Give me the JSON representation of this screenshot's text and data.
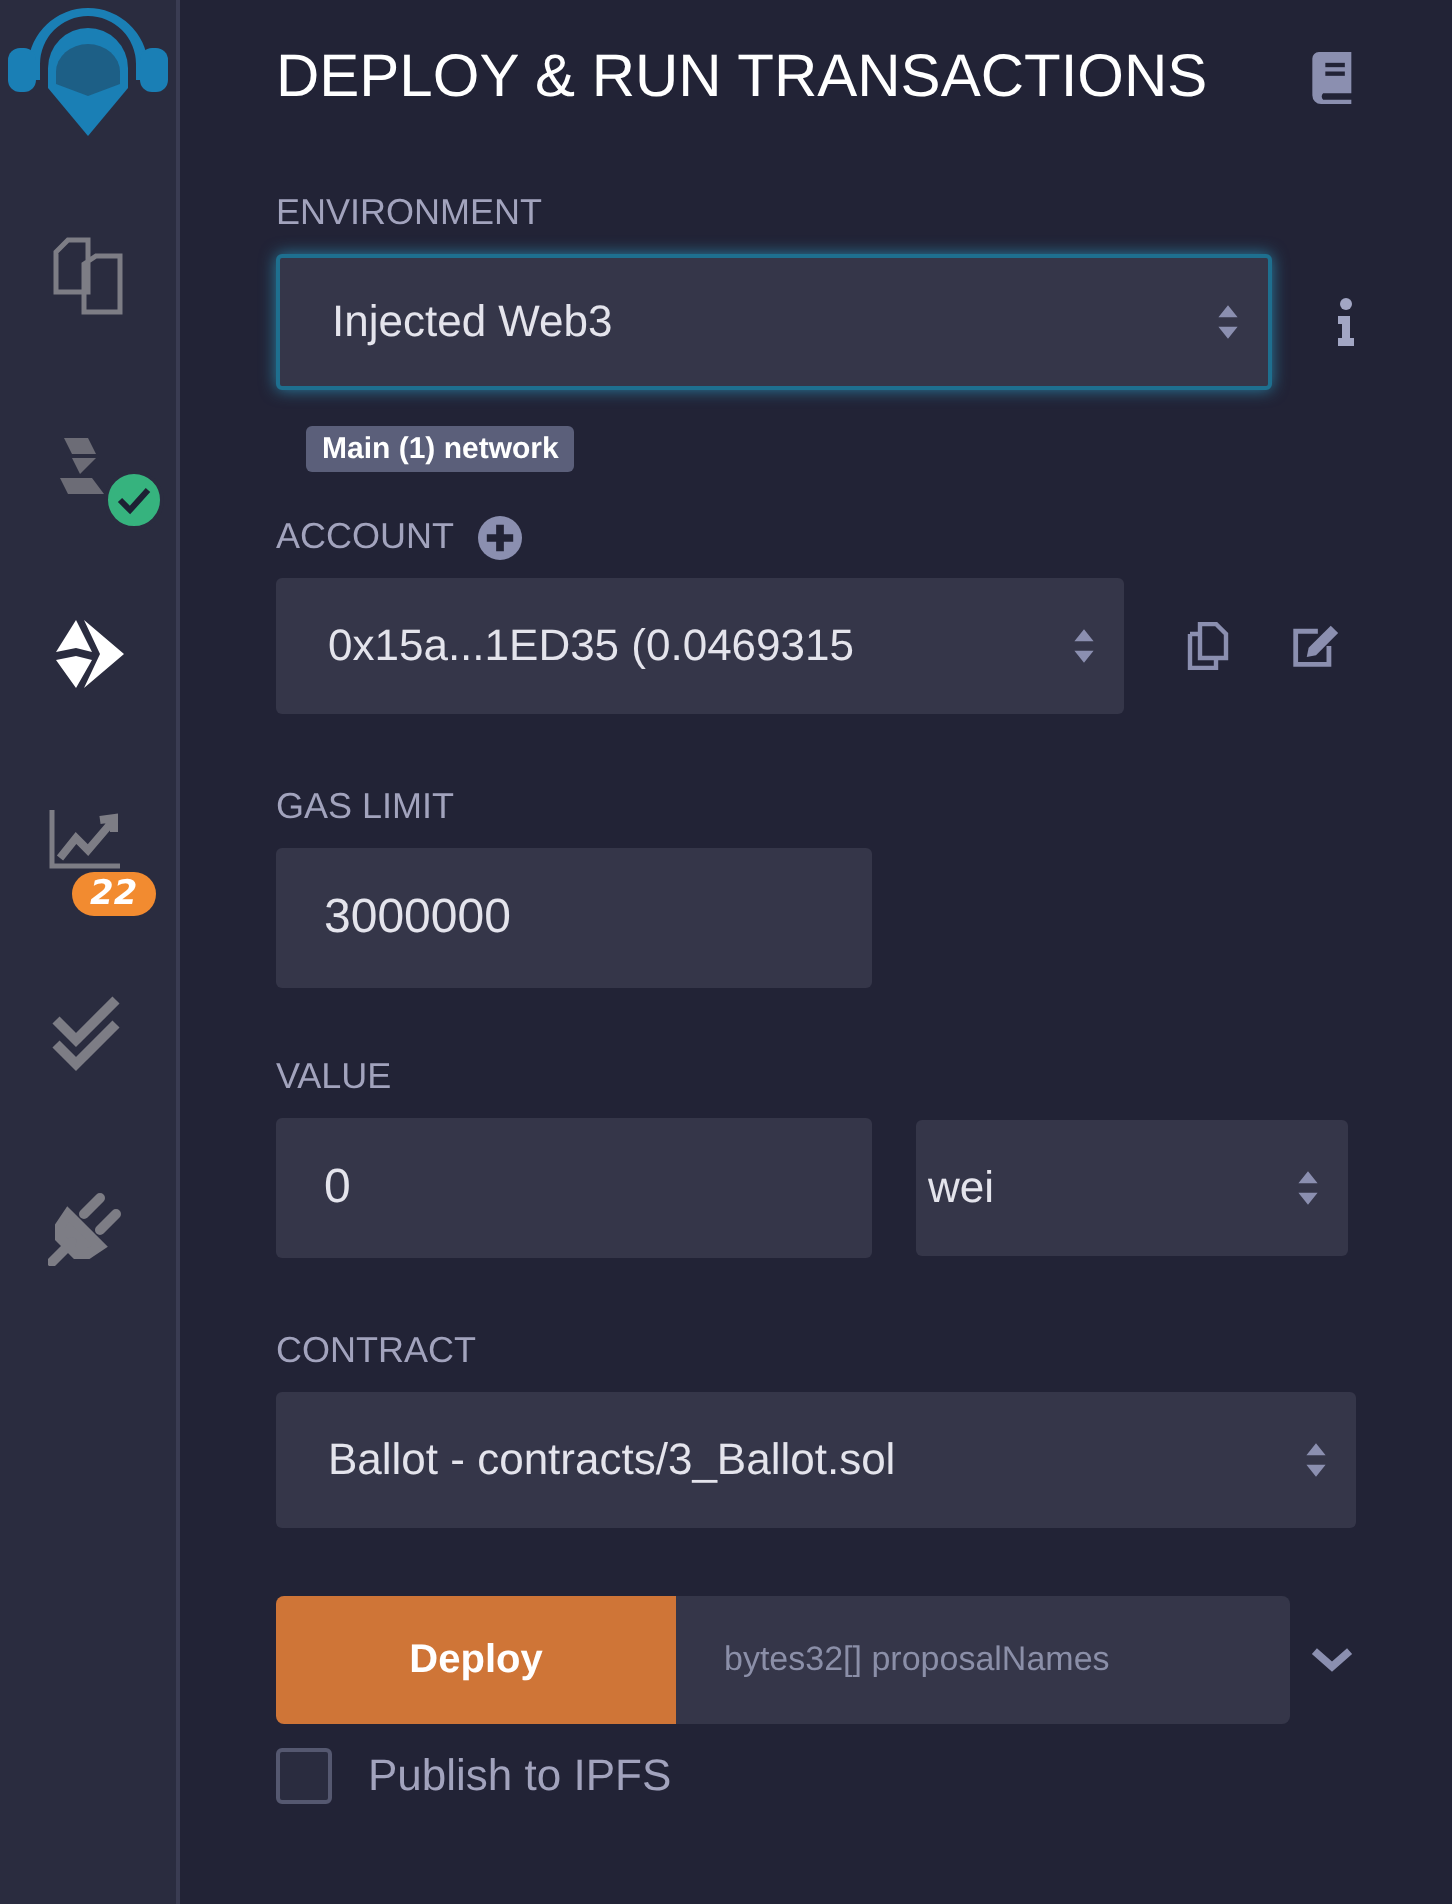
{
  "sidebar": {
    "items": [
      {
        "kind": "files",
        "selected": false
      },
      {
        "kind": "compiler",
        "selected": false,
        "compiled": true
      },
      {
        "kind": "deploy",
        "selected": true
      },
      {
        "kind": "analysis",
        "selected": false,
        "badge": "22"
      },
      {
        "kind": "tests",
        "selected": false
      },
      {
        "kind": "plugin",
        "selected": false
      }
    ]
  },
  "panel": {
    "title": "DEPLOY & RUN TRANSACTIONS",
    "environment": {
      "label": "ENVIRONMENT",
      "value": "Injected Web3",
      "focused": true,
      "network": "Main (1) network"
    },
    "account": {
      "label": "ACCOUNT",
      "value": "0x15a...1ED35 (0.0469315"
    },
    "gas_limit": {
      "label": "GAS LIMIT",
      "value": "3000000"
    },
    "value": {
      "label": "VALUE",
      "value": "0",
      "unit": "wei"
    },
    "contract": {
      "label": "CONTRACT",
      "value": "Ballot - contracts/3_Ballot.sol"
    },
    "deploy": {
      "button": "Deploy",
      "placeholder": "bytes32[] proposalNames"
    },
    "publish": {
      "label": "Publish to IPFS",
      "checked": false
    }
  }
}
